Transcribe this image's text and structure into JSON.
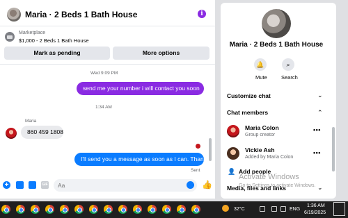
{
  "chat": {
    "title": "Maria · 2 Beds 1 Bath House",
    "info_icon": "info-icon",
    "listing": {
      "kicker": "Marketplace",
      "subtitle": "$1,000 - 2 Beds 1 Bath House",
      "mark_pending": "Mark as pending",
      "more_options": "More options"
    },
    "messages": {
      "timestamp1": "Wed 9:09 PM",
      "outgoing1": "send me your number i will contact you soon",
      "timestamp2": "1:34 AM",
      "sender": "Maria",
      "incoming1": "860 459 1808",
      "outgoing2": "I'll send you a message as soon as I can. Thanks",
      "status": "Sent"
    },
    "composer": {
      "placeholder": "Aa"
    },
    "colors": {
      "outgoing_purple": "#8a2be2",
      "outgoing_blue": "#0a7cff",
      "incoming": "#e9eaed"
    }
  },
  "info_pane": {
    "title": "Maria · 2 Beds 1 Bath House",
    "mute_label": "Mute",
    "search_label": "Search",
    "customize_chat": "Customize chat",
    "chat_members": "Chat members",
    "members": [
      {
        "name": "Maria Colon",
        "role": "Group creator"
      },
      {
        "name": "Vickie Ash",
        "role": "Added by Maria Colon"
      }
    ],
    "add_people": "Add people",
    "media_files_links": "Media, files and links"
  },
  "watermark": {
    "title": "Activate Windows",
    "subtitle": "Go to Settings to activate Windows."
  },
  "taskbar": {
    "app_icons": "chrome-icon",
    "temperature": "32°C",
    "language": "ENG",
    "time": "1:36 AM",
    "date": "6/19/2025"
  }
}
